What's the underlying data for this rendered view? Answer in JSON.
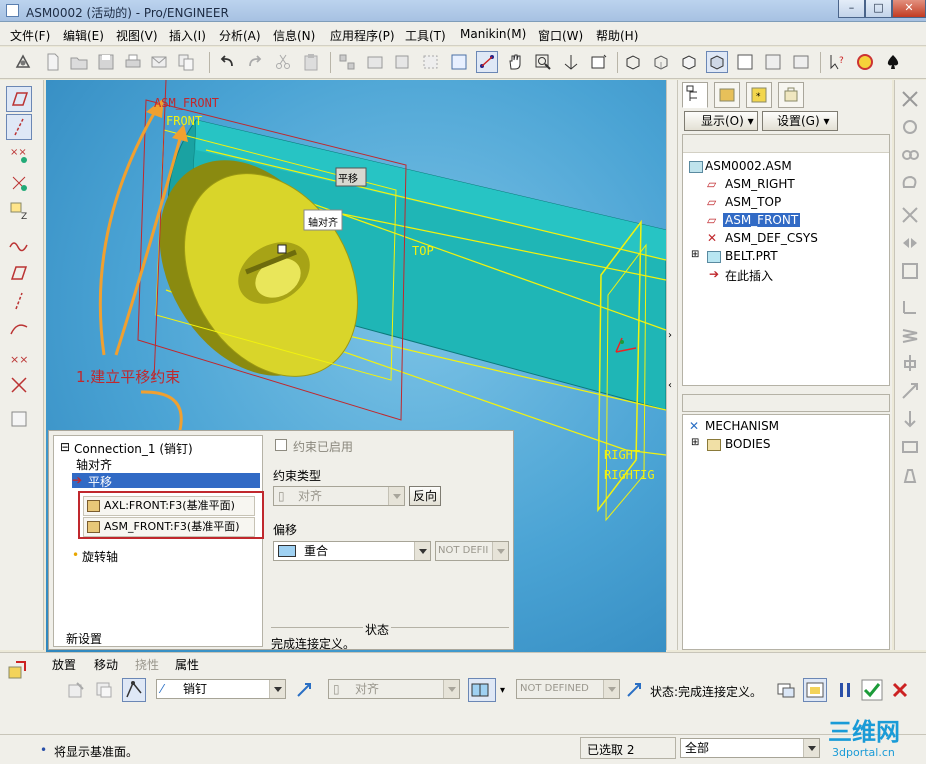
{
  "window": {
    "title": "ASM0002 (活动的) - Pro/ENGINEER",
    "buttons": [
      "minimize",
      "maximize",
      "close"
    ]
  },
  "menubar": {
    "items": [
      "文件(F)",
      "编辑(E)",
      "视图(V)",
      "插入(I)",
      "分析(A)",
      "信息(N)",
      "应用程序(P)",
      "工具(T)",
      "Manikin(M)",
      "窗口(W)",
      "帮助(H)"
    ]
  },
  "viewport": {
    "labels": {
      "asm_front": "ASM_FRONT",
      "front": "FRONT",
      "top": "TOP",
      "right1": "RIGHT",
      "right2": "RIGHTIG",
      "callout_translate": "平移",
      "callout_axis": "轴对齐"
    },
    "annotation": "1.建立平移约束",
    "colors": {
      "accent": "#c0282d",
      "annotation_arrow": "#f0a030",
      "part_yellow": "#d9d52a",
      "part_cyan": "#1fb6b6",
      "datum_yellow": "#f2f20f"
    }
  },
  "dialog": {
    "connection_label": "Connection_1 (销钉)",
    "tree": {
      "axis_align": "轴对齐",
      "translate": "平移",
      "ref1": "AXL:FRONT:F3(基准平面)",
      "ref2": "ASM_FRONT:F3(基准平面)",
      "rotation_axis": "旋转轴",
      "new_set": "新设置"
    },
    "constraint_enabled": "约束已启用",
    "constraint_type_label": "约束类型",
    "constraint_type_value": "对齐",
    "flip_button": "反向",
    "offset_label": "偏移",
    "offset_value": "重合",
    "offset_input": "NOT DEFII",
    "status_label": "状态",
    "status_text": "完成连接定义。"
  },
  "modeltree": {
    "display_button": "显示(O)",
    "settings_button": "设置(G)",
    "items": [
      {
        "label": "ASM0002.ASM",
        "icon": "assembly-icon"
      },
      {
        "label": "ASM_RIGHT",
        "icon": "datum-plane-icon"
      },
      {
        "label": "ASM_TOP",
        "icon": "datum-plane-icon"
      },
      {
        "label": "ASM_FRONT",
        "icon": "datum-plane-icon"
      },
      {
        "label": "ASM_DEF_CSYS",
        "icon": "csys-icon"
      },
      {
        "label": "BELT.PRT",
        "icon": "part-icon"
      },
      {
        "label": "在此插入",
        "icon": "insert-here-arrow-icon"
      }
    ],
    "mechanism": {
      "label": "MECHANISM",
      "bodies": "BODIES"
    }
  },
  "dashboard": {
    "tabs": [
      "放置",
      "移动",
      "挠性",
      "属性"
    ],
    "connection_type": "销钉",
    "constraint_combo": "对齐",
    "offset_combo": "NOT DEFINED",
    "status": "状态:完成连接定义。"
  },
  "statusbar": {
    "message": "将显示基准面。",
    "selected": "已选取 2",
    "filter": "全部"
  },
  "watermark": {
    "title": "三维网",
    "url": "3dportal.cn"
  }
}
